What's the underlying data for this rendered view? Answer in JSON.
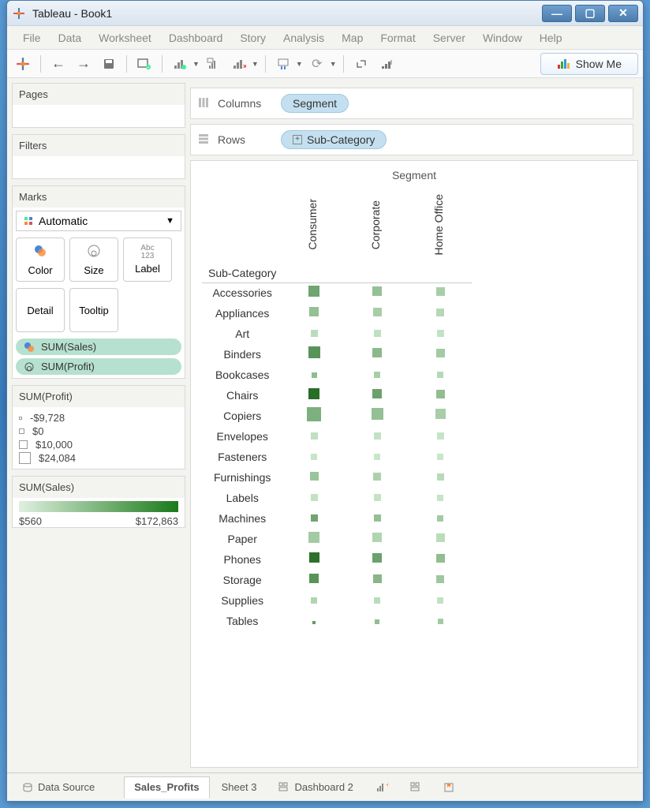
{
  "window": {
    "title": "Tableau - Book1"
  },
  "menu": [
    "File",
    "Data",
    "Worksheet",
    "Dashboard",
    "Story",
    "Analysis",
    "Map",
    "Format",
    "Server",
    "Window",
    "Help"
  ],
  "showme": "Show Me",
  "shelves": {
    "columns_label": "Columns",
    "rows_label": "Rows",
    "columns_pill": "Segment",
    "rows_pill": "Sub-Category"
  },
  "cards": {
    "pages": "Pages",
    "filters": "Filters",
    "marks": "Marks",
    "marks_type": "Automatic",
    "color": "Color",
    "size": "Size",
    "label": "Label",
    "detail": "Detail",
    "tooltip": "Tooltip",
    "pill_color": "SUM(Sales)",
    "pill_size": "SUM(Profit)"
  },
  "legend_size": {
    "title": "SUM(Profit)",
    "stops": [
      "-$9,728",
      "$0",
      "$10,000",
      "$24,084"
    ]
  },
  "legend_color": {
    "title": "SUM(Sales)",
    "min": "$560",
    "max": "$172,863"
  },
  "tabs": {
    "datasource": "Data Source",
    "items": [
      {
        "name": "Sales_Profits",
        "active": true
      },
      {
        "name": "Sheet 3",
        "active": false
      },
      {
        "name": "Dashboard 2",
        "active": false,
        "icon": "dash"
      }
    ]
  },
  "chart_data": {
    "type": "heatmap",
    "title": "Segment",
    "row_header": "Sub-Category",
    "columns": [
      "Consumer",
      "Corporate",
      "Home Office"
    ],
    "rows": [
      "Accessories",
      "Appliances",
      "Art",
      "Binders",
      "Bookcases",
      "Chairs",
      "Copiers",
      "Envelopes",
      "Fasteners",
      "Furnishings",
      "Labels",
      "Machines",
      "Paper",
      "Phones",
      "Storage",
      "Supplies",
      "Tables"
    ],
    "size_field": "SUM(Profit)",
    "size_range": [
      -9728,
      24084
    ],
    "color_field": "SUM(Sales)",
    "color_range": [
      560,
      172863
    ],
    "cells": {
      "Accessories": {
        "Consumer": {
          "sales": 95000,
          "profit": 14000
        },
        "Corporate": {
          "sales": 55000,
          "profit": 9000
        },
        "Home Office": {
          "sales": 35000,
          "profit": 7000
        }
      },
      "Appliances": {
        "Consumer": {
          "sales": 55000,
          "profit": 9000
        },
        "Corporate": {
          "sales": 35000,
          "profit": 6000
        },
        "Home Office": {
          "sales": 20000,
          "profit": 4000
        }
      },
      "Art": {
        "Consumer": {
          "sales": 15000,
          "profit": 3500
        },
        "Corporate": {
          "sales": 9000,
          "profit": 2500
        },
        "Home Office": {
          "sales": 6000,
          "profit": 1500
        }
      },
      "Binders": {
        "Consumer": {
          "sales": 120000,
          "profit": 16000
        },
        "Corporate": {
          "sales": 65000,
          "profit": 10000
        },
        "Home Office": {
          "sales": 40000,
          "profit": 6000
        }
      },
      "Bookcases": {
        "Consumer": {
          "sales": 60000,
          "profit": -2500
        },
        "Corporate": {
          "sales": 35000,
          "profit": -1000
        },
        "Home Office": {
          "sales": 20000,
          "profit": 500
        }
      },
      "Chairs": {
        "Consumer": {
          "sales": 172863,
          "profit": 14000
        },
        "Corporate": {
          "sales": 100000,
          "profit": 9000
        },
        "Home Office": {
          "sales": 60000,
          "profit": 6000
        }
      },
      "Copiers": {
        "Consumer": {
          "sales": 80000,
          "profit": 24084
        },
        "Corporate": {
          "sales": 55000,
          "profit": 16000
        },
        "Home Office": {
          "sales": 35000,
          "profit": 12000
        }
      },
      "Envelopes": {
        "Consumer": {
          "sales": 9000,
          "profit": 3500
        },
        "Corporate": {
          "sales": 6000,
          "profit": 2500
        },
        "Home Office": {
          "sales": 3500,
          "profit": 1500
        }
      },
      "Fasteners": {
        "Consumer": {
          "sales": 1500,
          "profit": 500
        },
        "Corporate": {
          "sales": 1000,
          "profit": 300
        },
        "Home Office": {
          "sales": 560,
          "profit": 200
        }
      },
      "Furnishings": {
        "Consumer": {
          "sales": 50000,
          "profit": 7000
        },
        "Corporate": {
          "sales": 30000,
          "profit": 4000
        },
        "Home Office": {
          "sales": 18000,
          "profit": 2000
        }
      },
      "Labels": {
        "Consumer": {
          "sales": 7000,
          "profit": 2800
        },
        "Corporate": {
          "sales": 4500,
          "profit": 1800
        },
        "Home Office": {
          "sales": 2800,
          "profit": 1000
        }
      },
      "Machines": {
        "Consumer": {
          "sales": 95000,
          "profit": 2000
        },
        "Corporate": {
          "sales": 55000,
          "profit": 1200
        },
        "Home Office": {
          "sales": 40000,
          "profit": 200
        }
      },
      "Paper": {
        "Consumer": {
          "sales": 40000,
          "profit": 14000
        },
        "Corporate": {
          "sales": 25000,
          "profit": 9000
        },
        "Home Office": {
          "sales": 15000,
          "profit": 6000
        }
      },
      "Phones": {
        "Consumer": {
          "sales": 170000,
          "profit": 13000
        },
        "Corporate": {
          "sales": 100000,
          "profit": 10000
        },
        "Home Office": {
          "sales": 60000,
          "profit": 7000
        }
      },
      "Storage": {
        "Consumer": {
          "sales": 120000,
          "profit": 10000
        },
        "Corporate": {
          "sales": 70000,
          "profit": 7000
        },
        "Home Office": {
          "sales": 45000,
          "profit": 4000
        }
      },
      "Supplies": {
        "Consumer": {
          "sales": 25000,
          "profit": -500
        },
        "Corporate": {
          "sales": 15000,
          "profit": 500
        },
        "Home Office": {
          "sales": 8000,
          "profit": -200
        }
      },
      "Tables": {
        "Consumer": {
          "sales": 110000,
          "profit": -9728
        },
        "Corporate": {
          "sales": 60000,
          "profit": -5000
        },
        "Home Office": {
          "sales": 40000,
          "profit": -3000
        }
      }
    }
  }
}
